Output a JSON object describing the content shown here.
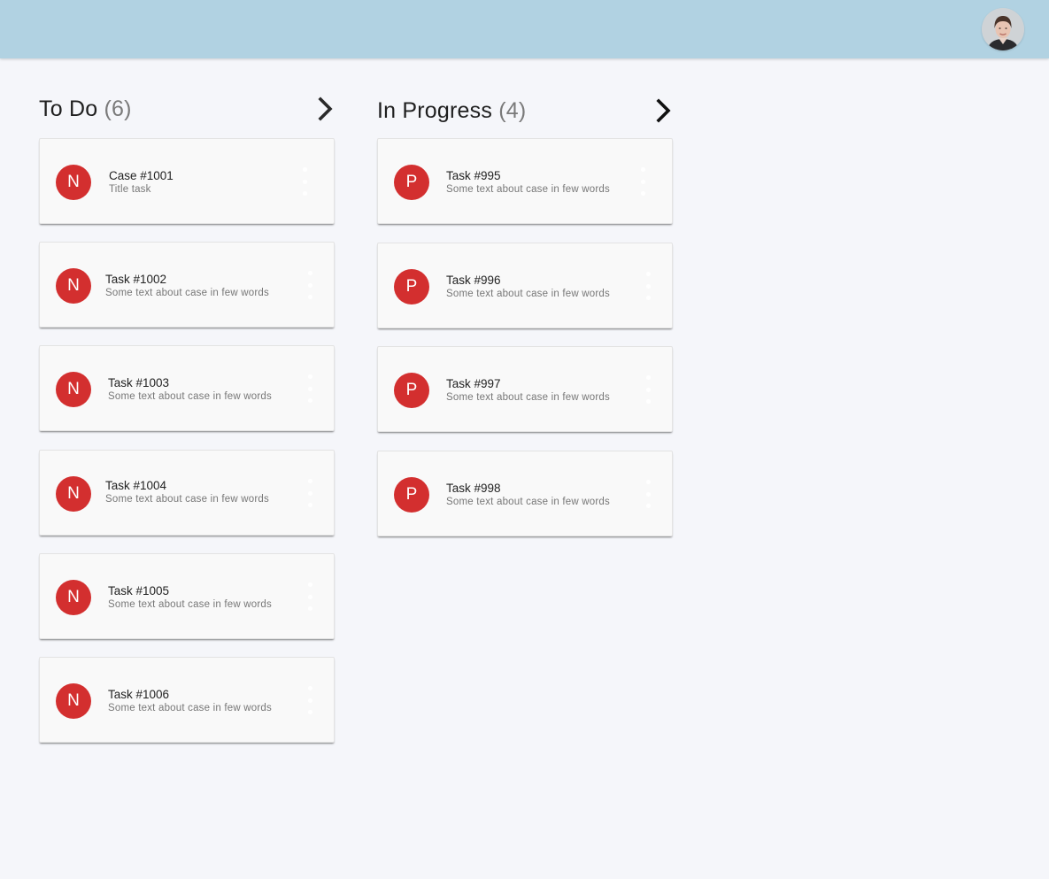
{
  "header": {
    "avatar_icon": "user-avatar-photo",
    "background_color": "#b1d2e2"
  },
  "columns": [
    {
      "title": "To Do",
      "count": "6",
      "chevron_icon": "chevron-right-icon",
      "cards": [
        {
          "avatar_letter": "N",
          "title": "Case #1001",
          "subtitle": "Title task",
          "menu_icon": "more-vertical-icon"
        },
        {
          "avatar_letter": "N",
          "title": "Task #1002",
          "subtitle": "Some text about case in few words",
          "menu_icon": "more-vertical-icon"
        },
        {
          "avatar_letter": "N",
          "title": "Task #1003",
          "subtitle": "Some text about case in few words",
          "menu_icon": "more-vertical-icon"
        },
        {
          "avatar_letter": "N",
          "title": "Task #1004",
          "subtitle": "Some text about case in few words",
          "menu_icon": "more-vertical-icon"
        },
        {
          "avatar_letter": "N",
          "title": "Task #1005",
          "subtitle": "Some text about case in few words",
          "menu_icon": "more-vertical-icon"
        },
        {
          "avatar_letter": "N",
          "title": "Task #1006",
          "subtitle": "Some text about case in few words",
          "menu_icon": "more-vertical-icon"
        }
      ]
    },
    {
      "title": "In Progress",
      "count": "4",
      "chevron_icon": "chevron-right-icon",
      "cards": [
        {
          "avatar_letter": "P",
          "title": "Task #995",
          "subtitle": "Some text about case in few words",
          "menu_icon": "more-vertical-icon"
        },
        {
          "avatar_letter": "P",
          "title": "Task #996",
          "subtitle": "Some text about case in few words",
          "menu_icon": "more-vertical-icon"
        },
        {
          "avatar_letter": "P",
          "title": "Task #997",
          "subtitle": "Some text about case in few words",
          "menu_icon": "more-vertical-icon"
        },
        {
          "avatar_letter": "P",
          "title": "Task #998",
          "subtitle": "Some text about case in few words",
          "menu_icon": "more-vertical-icon"
        }
      ]
    }
  ],
  "colors": {
    "page_background": "#f5f6fa",
    "card_background": "#f9f9f9",
    "avatar_red": "#d32f2f",
    "count_gray": "#7a7a7a"
  }
}
